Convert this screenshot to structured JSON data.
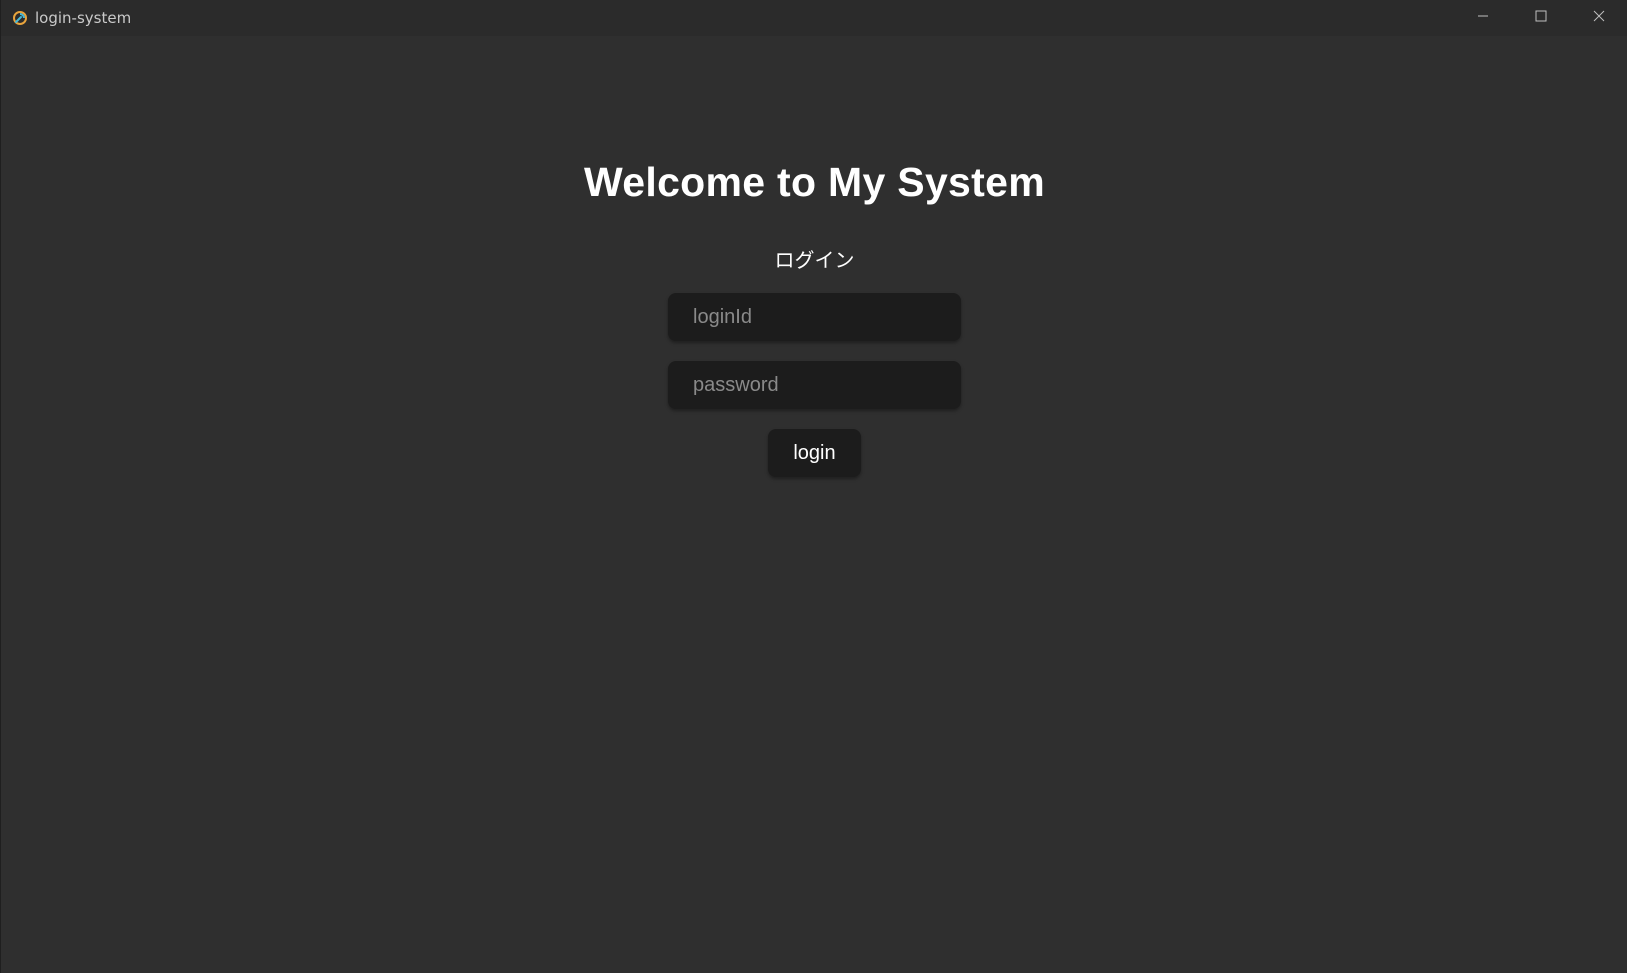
{
  "window": {
    "title": "login-system",
    "icon": "app-logo-icon",
    "controls": {
      "minimize_icon": "minimize-icon",
      "maximize_icon": "maximize-icon",
      "close_icon": "close-icon"
    }
  },
  "main": {
    "heading": "Welcome to My System",
    "subheading": "ログイン",
    "login_id": {
      "value": "",
      "placeholder": "loginId"
    },
    "password": {
      "value": "",
      "placeholder": "password"
    },
    "login_button_label": "login"
  },
  "colors": {
    "background": "#2f2f2f",
    "titlebar": "#2b2b2b",
    "input_background": "#1c1c1c",
    "text": "#ffffff",
    "placeholder": "#8a8a8a"
  }
}
